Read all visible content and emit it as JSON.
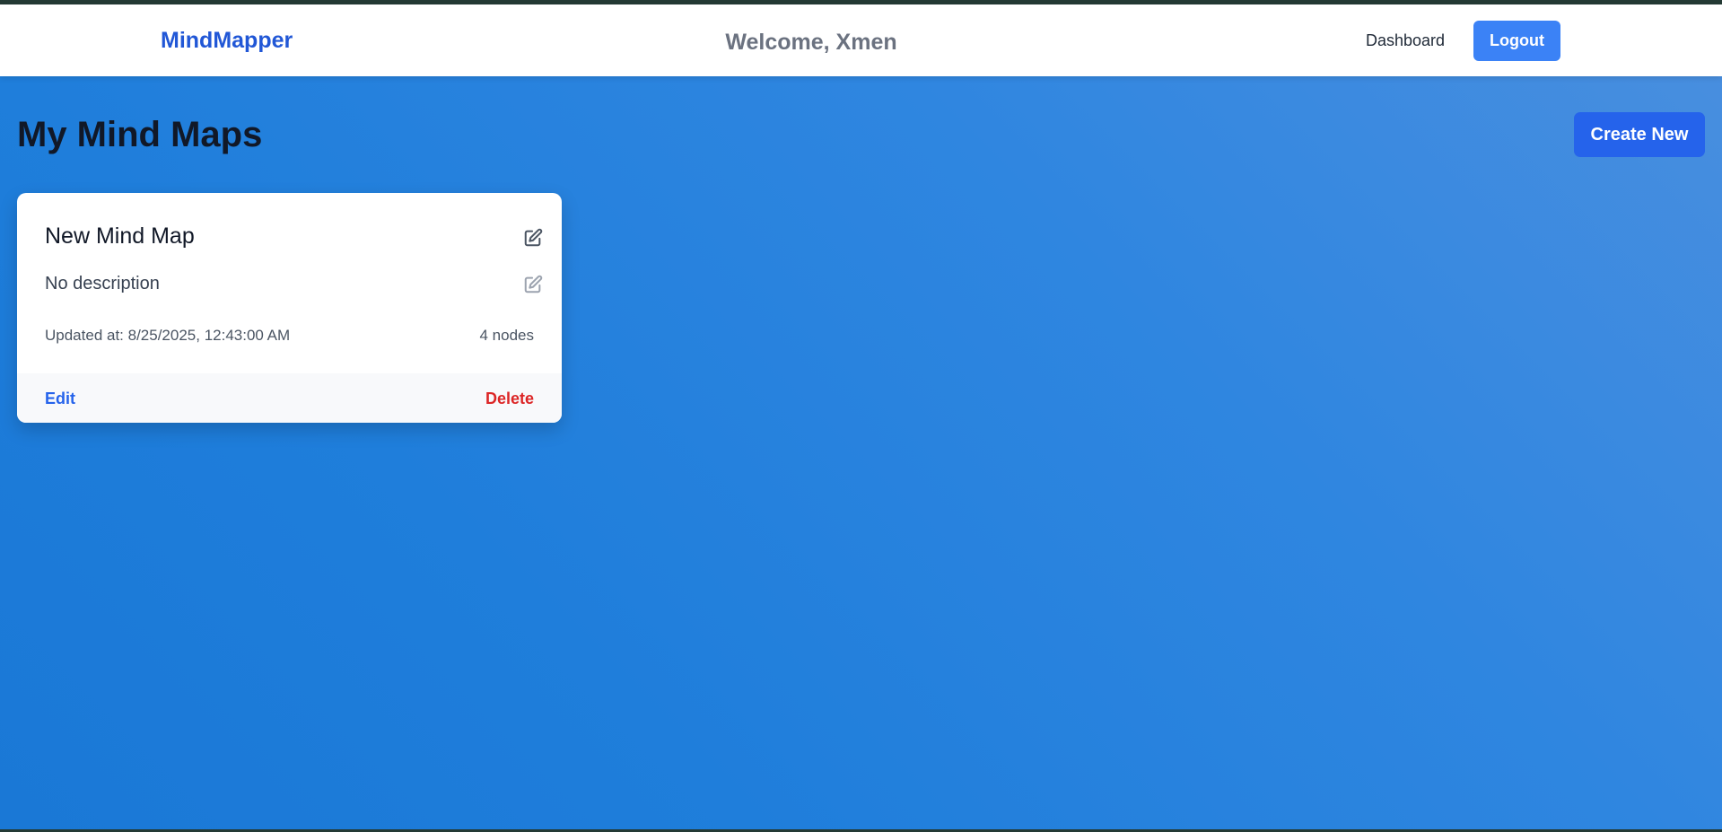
{
  "navbar": {
    "brand": "MindMapper",
    "welcome": "Welcome, Xmen",
    "dashboard_label": "Dashboard",
    "logout_label": "Logout"
  },
  "main": {
    "title": "My Mind Maps",
    "create_label": "Create New"
  },
  "cards": [
    {
      "title": "New Mind Map",
      "description": "No description",
      "updated": "Updated at: 8/25/2025, 12:43:00 AM",
      "nodes": "4 nodes",
      "edit_label": "Edit",
      "delete_label": "Delete",
      "icons": [
        "edit-icon",
        "edit-icon"
      ]
    }
  ],
  "colors": {
    "brand": "#2157d6",
    "primary_button": "#2563eb",
    "logout_button": "#3b82f6",
    "delete": "#dc2626",
    "background_gradient": [
      "#1a78d6",
      "#4a8fdf"
    ]
  }
}
